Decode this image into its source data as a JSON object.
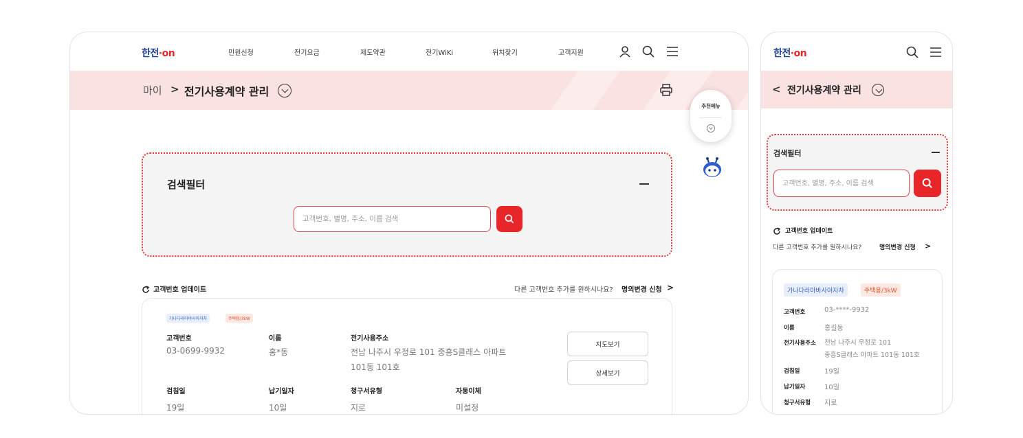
{
  "desktop": {
    "logo": {
      "part1": "한전",
      "part2": "·on"
    },
    "nav": [
      "민원신청",
      "전기요금",
      "제도약관",
      "전기WiKi",
      "위치찾기",
      "고객지원"
    ],
    "icons": [
      "user-icon",
      "search-icon",
      "menu-icon"
    ],
    "breadcrumb": {
      "parent": "마이",
      "separator": ">",
      "title": "전기사용계약 관리"
    },
    "filter": {
      "title": "검색필터",
      "placeholder": "고객번호, 별명, 주소, 이름 검색"
    },
    "update": {
      "label": "고객번호 업데이트",
      "prompt": "다른 고객번호 추가를 원하시나요?",
      "link": "명의변경 신청"
    },
    "card": {
      "tags": [
        "가나다라마바사아자차",
        "주택용/3kW"
      ],
      "fields": [
        {
          "label": "고객번호",
          "value": "03-0699-9932"
        },
        {
          "label": "이름",
          "value": "홍*동"
        },
        {
          "label": "전기사용주소",
          "value": "전남 나주시 우정로 101 중흥S클래스 아파트",
          "value2": "101동 101호"
        },
        {
          "label": "검침일",
          "value": "19일"
        },
        {
          "label": "납기일자",
          "value": "10일"
        },
        {
          "label": "청구서유형",
          "value": "지로"
        },
        {
          "label": "자동이체",
          "value": "미설정"
        }
      ],
      "buttons": [
        "지도보기",
        "상세보기"
      ]
    },
    "floating": {
      "label": "추천메뉴"
    }
  },
  "mobile": {
    "logo": {
      "part1": "한전",
      "part2": "·on"
    },
    "header": {
      "back": "<",
      "title": "전기사용계약 관리"
    },
    "filter": {
      "title": "검색필터",
      "placeholder": "고객번호, 별명, 주소, 이름 검색"
    },
    "update": {
      "label": "고객번호 업데이트",
      "prompt": "다른 고객번호 추가를 원하시나요?",
      "link": "명의변경 신청"
    },
    "card": {
      "tags": [
        "가나다라마바사아자차",
        "주택용/3kW"
      ],
      "fields": [
        {
          "label": "고객번호",
          "value": "03-****-9932"
        },
        {
          "label": "이름",
          "value": "홍길동"
        },
        {
          "label": "전기사용주소",
          "value": "전남 나주시 우정로 101",
          "value2": "중흥S클래스 아파트 101동 101호"
        },
        {
          "label": "검침일",
          "value": "19일"
        },
        {
          "label": "납기일자",
          "value": "10일"
        },
        {
          "label": "청구서유형",
          "value": "지로"
        }
      ]
    }
  },
  "colors": {
    "accent": "#e8262a",
    "band": "#fbe2e2",
    "logo_blue": "#1a3d8f"
  }
}
